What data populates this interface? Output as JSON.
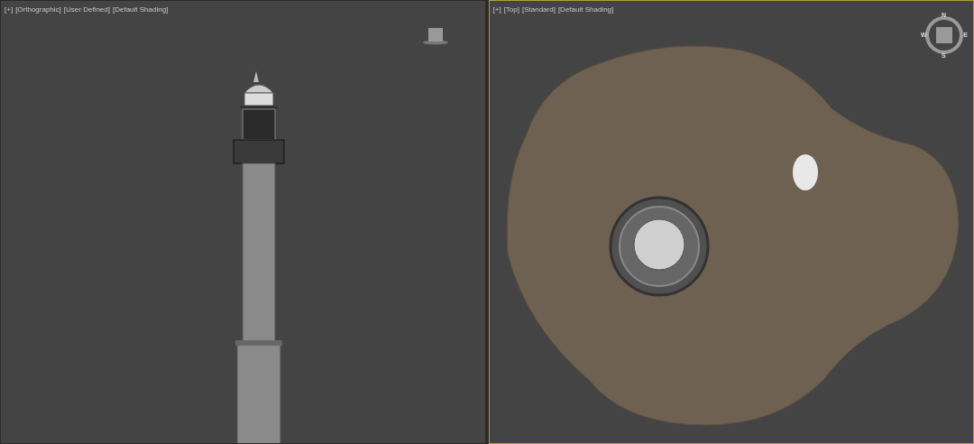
{
  "viewports": [
    {
      "kind": "orthographic",
      "active": false,
      "menus": [
        "[+]",
        "[Orthographic]",
        "[User Defined]",
        "[Default Shading]"
      ]
    },
    {
      "kind": "top",
      "active": true,
      "menus": [
        "[+]",
        "[Top]",
        "[Standard]",
        "[Default Shading]"
      ],
      "compass": [
        "N",
        "E",
        "S",
        "W"
      ]
    }
  ]
}
